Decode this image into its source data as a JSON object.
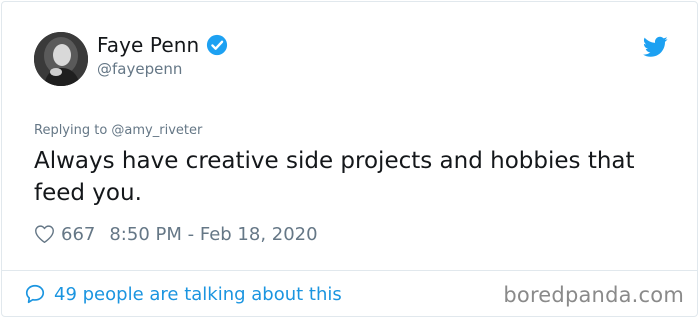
{
  "user": {
    "name": "Faye Penn",
    "handle": "@fayepenn"
  },
  "tweet": {
    "replying_to": "Replying to @amy_riveter",
    "text": "Always have creative side projects and hobbies that feed you.",
    "likes": "667",
    "timestamp": "8:50 PM - Feb 18, 2020"
  },
  "footer": {
    "talking": "49 people are talking about this",
    "watermark": "boredpanda.com"
  },
  "icons": {
    "verified": "verified-badge-icon",
    "bird": "twitter-bird-icon",
    "heart": "heart-outline-icon",
    "bubble": "speech-bubble-icon"
  },
  "colors": {
    "accent": "#1da1f2",
    "link": "#1b95e0",
    "text": "#14171a",
    "muted": "#657786"
  }
}
